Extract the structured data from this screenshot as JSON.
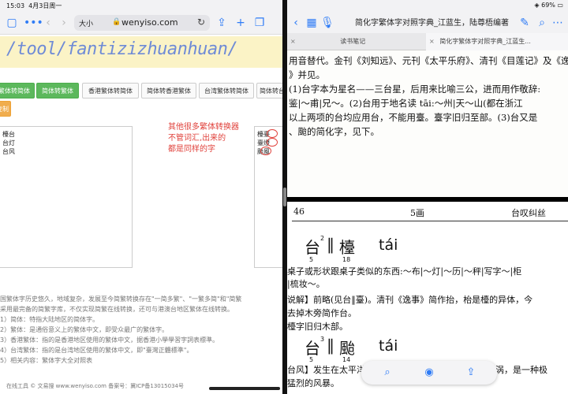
{
  "left": {
    "status": {
      "time": "15:03",
      "date": "4月3日周一"
    },
    "toolbar": {
      "aa": "大小",
      "url": "wenyiso.com",
      "reload": "↻"
    },
    "banner": {
      "path": "/tool/fantizizhuanhuan/"
    },
    "buttons": [
      "繁体转简体",
      "简体转繁体",
      "香港繁体转简体",
      "简体转香港繁体",
      "台湾繁体转简体",
      "简体转台"
    ],
    "button2": "复制",
    "input_lines": [
      "檯台",
      "台灯",
      "台风"
    ],
    "output_lines": [
      "檯臺",
      "臺燈",
      "颱風"
    ],
    "annotation": [
      "其他很多繁体转换器",
      "不管词汇,出来的",
      "都是同样的字"
    ],
    "description": [
      "国繁体字历史悠久，地域复杂，发展至今简繁转换存在\"一简多繁\"、\"一繁多简\"和\"简繁",
      "采用最完备的简繁字库，不仅实现简繁在线转换，还可与港澳台地区繁体在线转换。",
      "1）简体：特指大陆地区的简体字。",
      "2）繁体：是通俗意义上的繁体中文，即受众最广的繁体字。",
      "3）香港繁体：指的是香港地区使用的繁体中文，据香港小學學習字詞表標準。",
      "4）台湾繁体：指的是台湾地区使用的繁体中文，即\"臺灣正體標準\"。",
      "5）相关内容：繁体字大全对照表"
    ],
    "footer": "在线工具 © 文易搜 www.wenyiso.com 备案号：冀ICP备13015034号"
  },
  "right": {
    "status": "69%",
    "title": "简化字繁体字对照字典_江蓝生，陆尊梧编著",
    "tabs": [
      "读书笔记",
      "简化字繁体字对照字典_江蓝生..."
    ],
    "page_top": [
      "用音替代。金刊《刘知远》、元刊《太平乐府》、清刊《目莲记》及《逸",
      "》并见。",
      "(1)台字本为星名——三台星，后用来比喻三公，进而用作敬辞:",
      "鉴|～甫|兄～。(2)台用于地名读 tāi:～州|天～山(都在浙江",
      "以上两项的台均应用台，不能用臺。臺字旧归至部。(3)台又是",
      "、颱的简化字，见下。"
    ],
    "runhead": {
      "page": "46",
      "section": "5画",
      "range": "台叹纠丝"
    },
    "entry1": {
      "char1": "台",
      "sup": "2",
      "bar": "‖",
      "char2": "檯",
      "num1": "5",
      "num2": "18",
      "pinyin": "tái"
    },
    "entry1_lines": [
      "桌子或形状跟桌子类似的东西:～布|～灯|～历|～秤|写字～|柜",
      "|梳妆～。",
      "说解】前略(见台‖臺)。清刊《逸事》简作抬，枱是檯的异体，今",
      "去掉木旁简作台。",
      "檯字旧归木部。"
    ],
    "entry2": {
      "char1": "台",
      "sup": "3",
      "bar": "‖",
      "char2": "颱",
      "num1": "5",
      "num2": "14",
      "pinyin": "tái"
    },
    "entry2_lines": [
      "台风】发生在太平洋西部海洋和南海海上的热带空气旋涡，是一种极",
      "猛烈的风暴。"
    ]
  }
}
